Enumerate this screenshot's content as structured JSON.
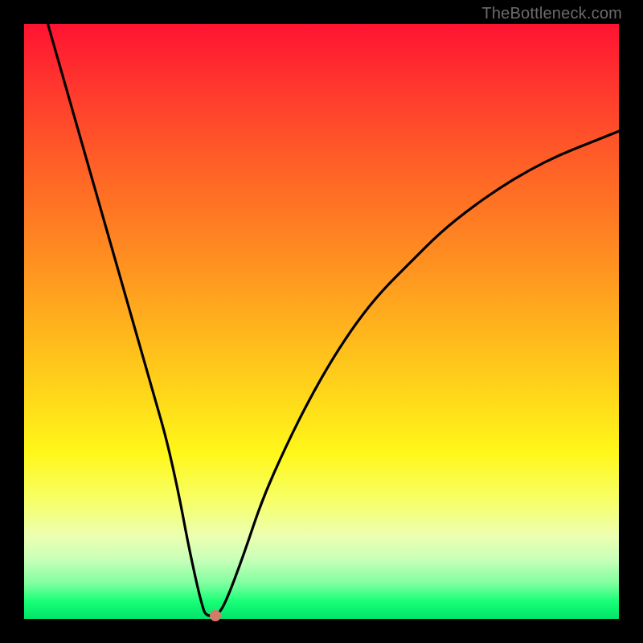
{
  "watermark": "TheBottleneck.com",
  "colors": {
    "frame": "#000000",
    "curve_stroke": "#000000",
    "marker_fill": "#d6786a",
    "gradient_stops": [
      "#ff1331",
      "#ff6426",
      "#ffd61a",
      "#f7ff66",
      "#00e46a"
    ]
  },
  "chart_data": {
    "type": "line",
    "title": "",
    "xlabel": "",
    "ylabel": "",
    "xlim": [
      0,
      100
    ],
    "ylim": [
      0,
      100
    ],
    "grid": false,
    "legend": false,
    "series": [
      {
        "name": "bottleneck-curve",
        "x": [
          4,
          6,
          8,
          10,
          12,
          14,
          16,
          18,
          20,
          22,
          24,
          26,
          27.5,
          29,
          30,
          30.6,
          32.5,
          34,
          37,
          40,
          44,
          48,
          52,
          56,
          60,
          65,
          70,
          75,
          80,
          85,
          90,
          95,
          100
        ],
        "y": [
          100,
          93,
          86,
          79,
          72,
          65,
          58,
          51,
          44,
          37,
          30,
          21,
          13,
          6,
          2,
          0.5,
          0.5,
          3,
          11,
          20,
          29,
          37,
          44,
          50,
          55,
          60,
          65,
          69,
          72.5,
          75.5,
          78,
          80,
          82
        ]
      }
    ],
    "annotations": [
      {
        "name": "min-marker",
        "x": 32.2,
        "y": 0.5
      }
    ]
  }
}
